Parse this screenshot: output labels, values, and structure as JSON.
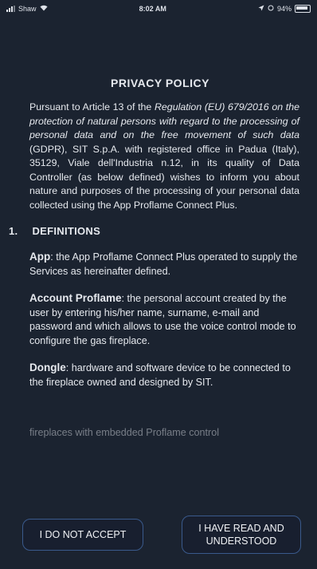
{
  "status_bar": {
    "carrier": "Shaw",
    "time": "8:02 AM",
    "battery": "94%"
  },
  "policy": {
    "title": "PRIVACY POLICY",
    "intro": [
      {
        "t": "Pursuant to Article 13 of the ",
        "i": false
      },
      {
        "t": "Regulation (EU) 679/2016 on the protection of natural persons with regard to the processing of personal data and on the free movement of such data",
        "i": true
      },
      {
        "t": " (GDPR), SIT S.p.A. with registered office in Padua (Italy), 35129, Viale dell'Industria n.12, in its quality of Data Controller (as below defined) wishes to inform you about nature and purposes of the processing of your personal data collected using the App Proflame Connect Plus.",
        "i": false
      }
    ],
    "section_number": "1.",
    "section_title": "DEFINITIONS",
    "definitions": [
      {
        "term": "App",
        "text": ": the App Proflame Connect Plus operated to supply the Services as hereinafter defined."
      },
      {
        "term": "Account Proflame",
        "text": ": the personal account created by the user by entering his/her name, surname, e-mail and password and which allows to use the voice control mode to configure the gas fireplace."
      },
      {
        "term": "Dongle",
        "text": ": hardware and software device to be connected to the fireplace owned and designed by SIT."
      }
    ],
    "partial_text": "fireplaces with embedded Proflame control"
  },
  "buttons": {
    "reject": "I DO NOT ACCEPT",
    "accept": "I HAVE READ AND UNDERSTOOD"
  },
  "colors": {
    "background": "#1b2330",
    "button_border": "#3a5a8c"
  }
}
